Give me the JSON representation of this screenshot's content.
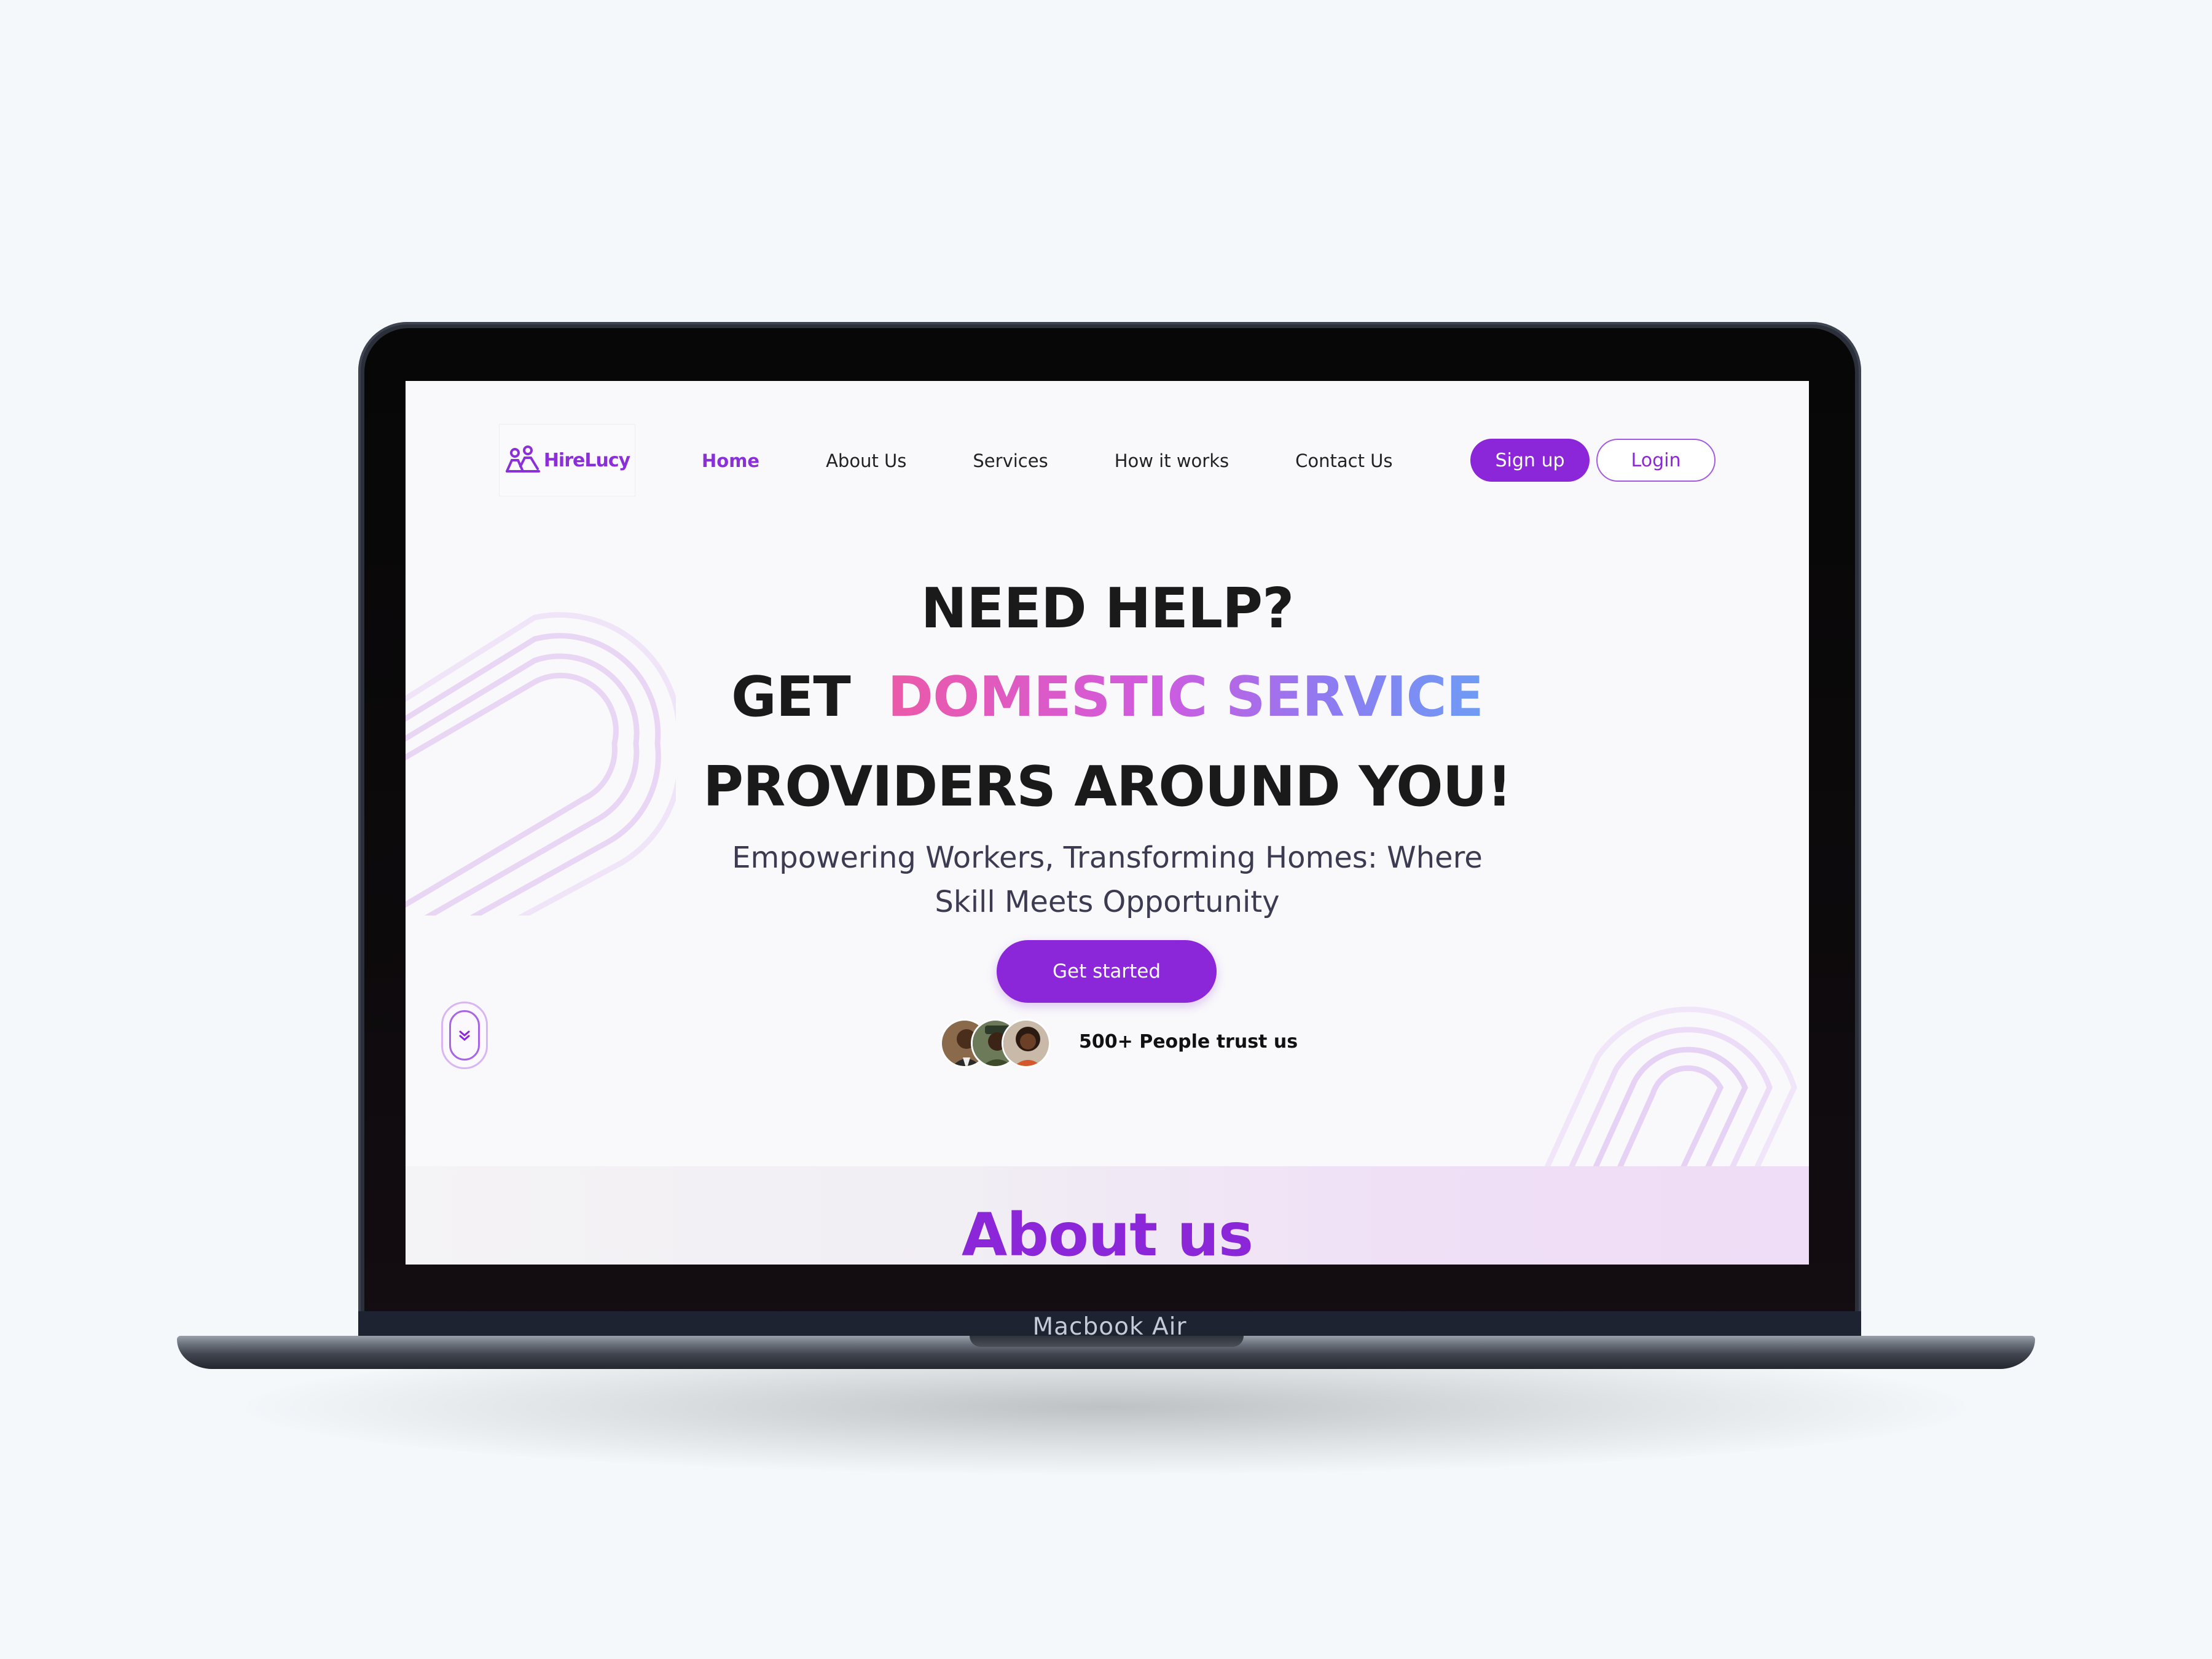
{
  "device": {
    "label": "Macbook Air"
  },
  "brand": {
    "name": "HireLucy",
    "accent": "#8b26d9"
  },
  "nav": {
    "items": [
      {
        "label": "Home",
        "active": true
      },
      {
        "label": "About Us"
      },
      {
        "label": "Services"
      },
      {
        "label": "How it works"
      },
      {
        "label": "Contact Us"
      }
    ],
    "signup_label": "Sign up",
    "login_label": "Login"
  },
  "hero": {
    "line1": "NEED HELP?",
    "line2_prefix": "GET",
    "line2_highlight": "DOMESTIC SERVICE",
    "line3": "PROVIDERS AROUND YOU!",
    "subtitle": "Empowering Workers, Transforming Homes: Where Skill Meets Opportunity",
    "cta_label": "Get started",
    "trust_text": "500+ People trust us",
    "highlight_gradient": [
      "#ec5aa8",
      "#d05adf",
      "#8c7cf2",
      "#6e9cf4"
    ]
  },
  "about": {
    "title": "About us"
  },
  "icons": {
    "logo": "people-icon",
    "scroll": "chevron-double-down-icon"
  }
}
